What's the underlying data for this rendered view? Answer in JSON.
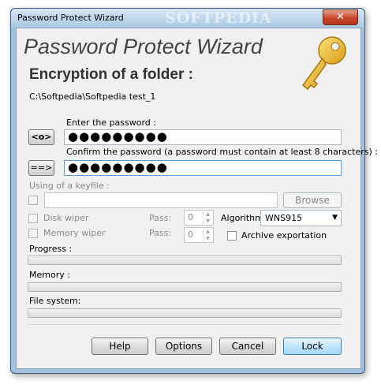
{
  "window": {
    "title": "Password Protect Wizard",
    "watermark": "SOFTPEDIA",
    "close_glyph": "✕"
  },
  "header": {
    "title": "Password Protect Wizard",
    "subtitle": "Encryption of a folder :",
    "folder_path": "C:\\Softpedia\\Softpedia test_1",
    "key_icon": "key-icon"
  },
  "password": {
    "label": "Enter the password :",
    "value": "●●●●●●●●●",
    "toggle_button": "<o>"
  },
  "confirm": {
    "label": "Confirm the password (a password must contain at least 8 characters) :",
    "value": "●●●●●●●●●",
    "copy_button": "==>"
  },
  "keyfile": {
    "label": "Using of a keyfile :",
    "path_value": "",
    "browse_button": "Browse"
  },
  "options": {
    "disk_wiper_label": "Disk wiper",
    "memory_wiper_label": "Memory wiper",
    "pass_label": "Pass:",
    "disk_pass_value": "0",
    "memory_pass_value": "0",
    "algorithm_label": "Algorithm:",
    "algorithm_value": "WNS915",
    "archive_label": "Archive exportation"
  },
  "progress": {
    "progress_label": "Progress :",
    "memory_label": "Memory :",
    "filesystem_label": "File system:",
    "progress_value": 0,
    "memory_value": 0,
    "filesystem_value": 0
  },
  "buttons": {
    "help": "Help",
    "options": "Options",
    "cancel": "Cancel",
    "lock": "Lock"
  },
  "colors": {
    "accent_frame": "#9fc1de",
    "key_gold": "#e8b52a"
  }
}
